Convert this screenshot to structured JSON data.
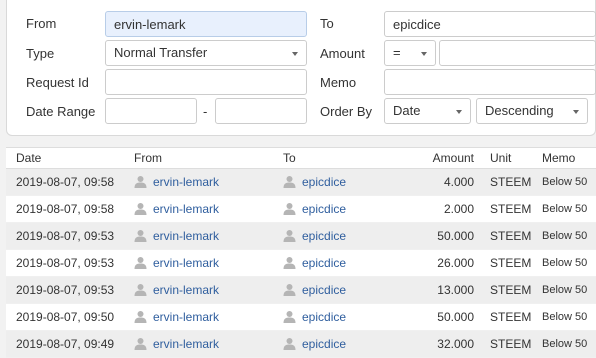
{
  "filters": {
    "from_label": "From",
    "from_value": "ervin-lemark",
    "to_label": "To",
    "to_value": "epicdice",
    "type_label": "Type",
    "type_value": "Normal Transfer",
    "amount_label": "Amount",
    "amount_op": "=",
    "amount_value": "",
    "request_label": "Request Id",
    "request_value": "",
    "memo_label": "Memo",
    "memo_value": "",
    "date_range_label": "Date Range",
    "date_separator": "-",
    "date_start": "",
    "date_end": "",
    "order_label": "Order By",
    "order_field": "Date",
    "order_direction": "Descending"
  },
  "table": {
    "headers": {
      "date": "Date",
      "from": "From",
      "to": "To",
      "amount": "Amount",
      "unit": "Unit",
      "memo": "Memo"
    },
    "rows": [
      {
        "date": "2019-08-07, 09:58",
        "from": "ervin-lemark",
        "to": "epicdice",
        "amount": "4.000",
        "unit": "STEEM",
        "memo": "Below 50"
      },
      {
        "date": "2019-08-07, 09:58",
        "from": "ervin-lemark",
        "to": "epicdice",
        "amount": "2.000",
        "unit": "STEEM",
        "memo": "Below 50"
      },
      {
        "date": "2019-08-07, 09:53",
        "from": "ervin-lemark",
        "to": "epicdice",
        "amount": "50.000",
        "unit": "STEEM",
        "memo": "Below 50"
      },
      {
        "date": "2019-08-07, 09:53",
        "from": "ervin-lemark",
        "to": "epicdice",
        "amount": "26.000",
        "unit": "STEEM",
        "memo": "Below 50"
      },
      {
        "date": "2019-08-07, 09:53",
        "from": "ervin-lemark",
        "to": "epicdice",
        "amount": "13.000",
        "unit": "STEEM",
        "memo": "Below 50"
      },
      {
        "date": "2019-08-07, 09:50",
        "from": "ervin-lemark",
        "to": "epicdice",
        "amount": "50.000",
        "unit": "STEEM",
        "memo": "Below 50"
      },
      {
        "date": "2019-08-07, 09:49",
        "from": "ervin-lemark",
        "to": "epicdice",
        "amount": "32.000",
        "unit": "STEEM",
        "memo": "Below 50"
      }
    ]
  },
  "colors": {
    "user_link": "#2f5e9e",
    "row_alt": "#eeeeee",
    "focus_bg": "#e8f0fd"
  },
  "icons": {
    "user": "user-icon",
    "caret": "chevron-down-icon"
  }
}
